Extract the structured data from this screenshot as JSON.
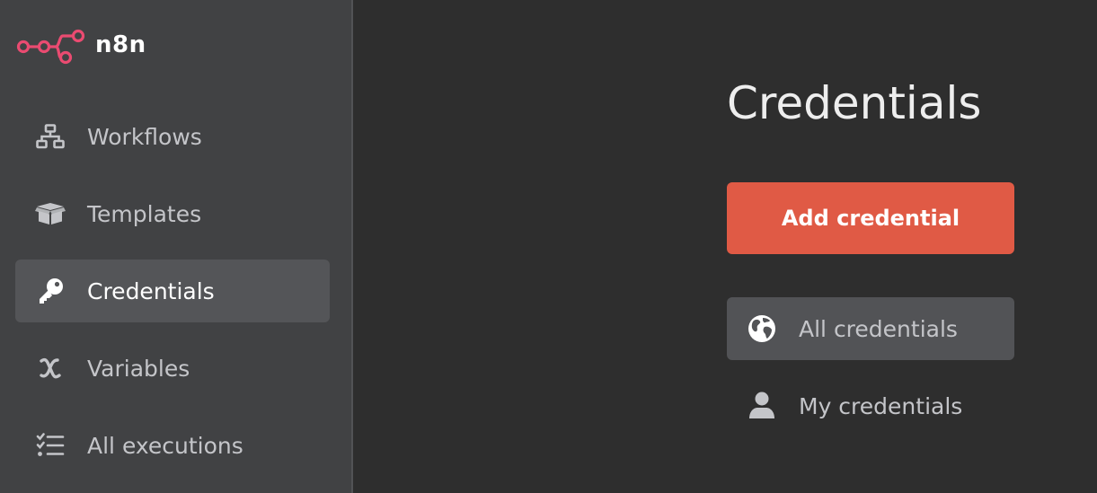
{
  "brand": {
    "name": "n8n",
    "logo_icon": "n8n-logo-icon",
    "accent_color": "#e05a45",
    "logo_color": "#ea4b71"
  },
  "sidebar": {
    "items": [
      {
        "label": "Workflows",
        "icon": "workflows-icon",
        "active": false
      },
      {
        "label": "Templates",
        "icon": "templates-box-icon",
        "active": false
      },
      {
        "label": "Credentials",
        "icon": "key-icon",
        "active": true
      },
      {
        "label": "Variables",
        "icon": "variables-icon",
        "active": false
      },
      {
        "label": "All executions",
        "icon": "executions-list-icon",
        "active": false
      }
    ]
  },
  "main": {
    "title": "Credentials",
    "add_button_label": "Add credential",
    "filters": [
      {
        "label": "All credentials",
        "icon": "globe-icon",
        "active": true
      },
      {
        "label": "My credentials",
        "icon": "user-icon",
        "active": false
      }
    ]
  }
}
